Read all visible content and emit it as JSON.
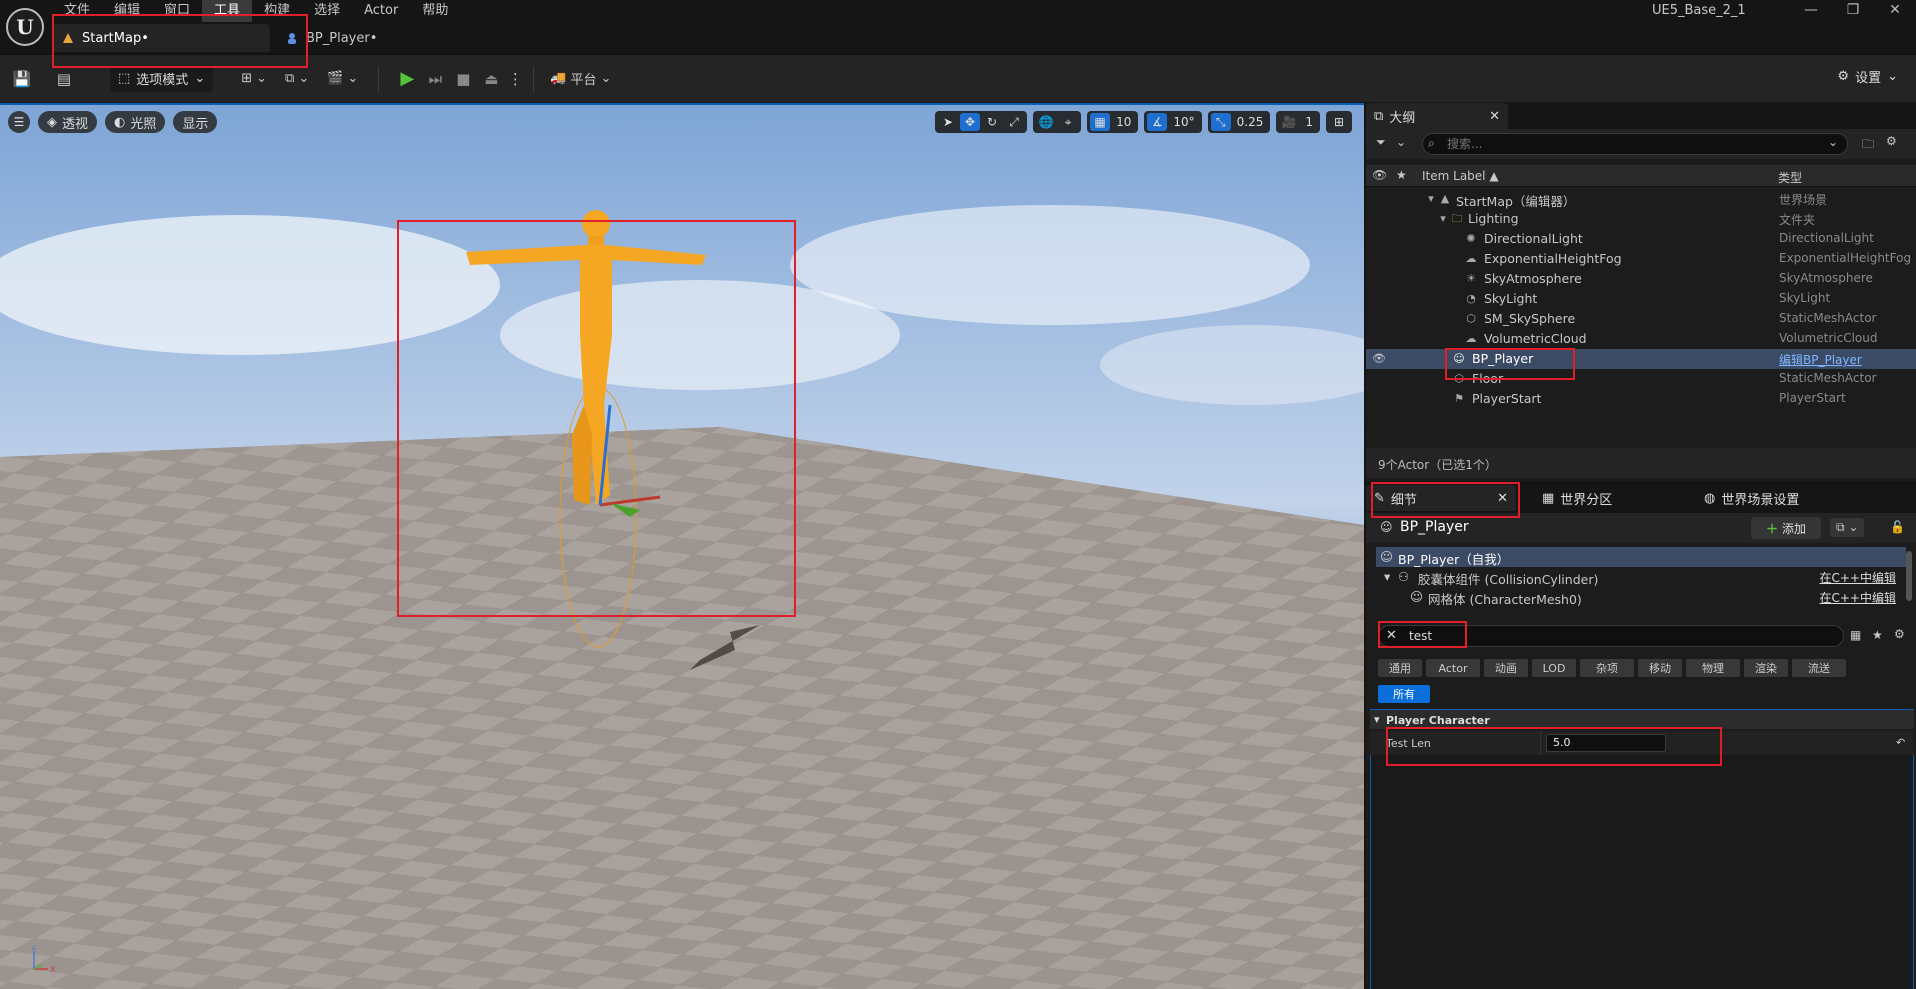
{
  "menu": [
    "文件",
    "编辑",
    "窗口",
    "工具",
    "构建",
    "选择",
    "Actor",
    "帮助"
  ],
  "project_name": "UE5_Base_2_1",
  "doc_tabs": [
    {
      "label": "StartMap•"
    },
    {
      "label": "BP_Player•"
    }
  ],
  "toolbar": {
    "mode_label": "选项模式",
    "platform_label": "平台",
    "settings_label": "设置"
  },
  "viewport": {
    "perspective_label": "透视",
    "lighting_label": "光照",
    "show_label": "显示",
    "grid_snap": "10",
    "rot_snap": "10°",
    "scale_snap": "0.25",
    "camera_speed": "1"
  },
  "outliner": {
    "tab_label": "大纲",
    "search_placeholder": "搜索...",
    "col_label": "Item Label ▲",
    "col_type": "类型",
    "rows": [
      {
        "label": "StartMap（编辑器）",
        "type": "世界场景"
      },
      {
        "label": "Lighting",
        "type": "文件夹"
      },
      {
        "label": "DirectionalLight",
        "type": "DirectionalLight"
      },
      {
        "label": "ExponentialHeightFog",
        "type": "ExponentialHeightFog"
      },
      {
        "label": "SkyAtmosphere",
        "type": "SkyAtmosphere"
      },
      {
        "label": "SkyLight",
        "type": "SkyLight"
      },
      {
        "label": "SM_SkySphere",
        "type": "StaticMeshActor"
      },
      {
        "label": "VolumetricCloud",
        "type": "VolumetricCloud"
      },
      {
        "label": "BP_Player",
        "type": "编辑BP_Player"
      },
      {
        "label": "Floor",
        "type": "StaticMeshActor"
      },
      {
        "label": "PlayerStart",
        "type": "PlayerStart"
      }
    ],
    "footer": "9个Actor（已选1个）"
  },
  "details": {
    "tab_label": "细节",
    "world_partition_label": "世界分区",
    "world_settings_label": "世界场景设置",
    "actor_name": "BP_Player",
    "add_label": "添加",
    "components": [
      {
        "label": "BP_Player（自我）",
        "action": ""
      },
      {
        "label": "胶囊体组件 (CollisionCylinder)",
        "action": "在C++中编辑"
      },
      {
        "label": "网格体 (CharacterMesh0)",
        "action": "在C++中编辑"
      }
    ],
    "search_value": "test",
    "filters": [
      "通用",
      "Actor",
      "动画",
      "LOD",
      "杂项",
      "移动",
      "物理",
      "渲染",
      "流送"
    ],
    "all_label": "所有",
    "category": "Player Character",
    "property_name": "Test Len",
    "property_value": "5.0"
  },
  "colors": {
    "accent": "#0a6fd8",
    "highlight_box": "#e01f2a",
    "selection": "#3b4b66",
    "character": "#f5a623"
  }
}
